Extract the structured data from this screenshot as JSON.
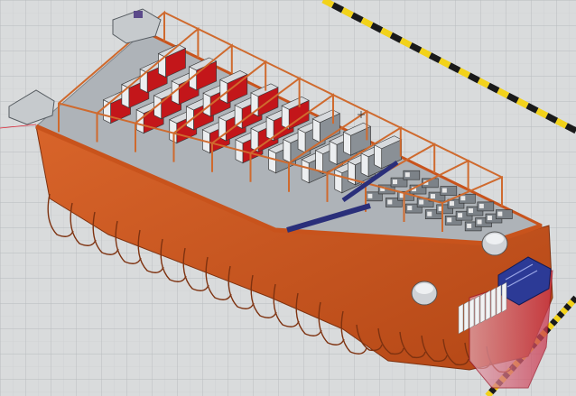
{
  "viewport": {
    "background": "#d9dbdc",
    "grid_color": "#b7bbbe",
    "grid_minor_color": "#c9cccd"
  },
  "model": {
    "hull_color": "#c8531c",
    "hull_dark": "#a13f12",
    "hull_shadow": "#7e3210",
    "frame_color": "#cf6a2e",
    "deck_color": "#aeb3b8",
    "equipment_red": "#c3161a",
    "equipment_white": "#eceef0",
    "equipment_gray": "#8a9096",
    "conveyor_blue": "#2a2f7a",
    "pump_blue": "#2c3a96"
  },
  "hazard_stripe": {
    "yellow": "#f2d21a",
    "black": "#1a1a1a"
  },
  "cursor": {
    "icon": "crosshair-icon"
  }
}
